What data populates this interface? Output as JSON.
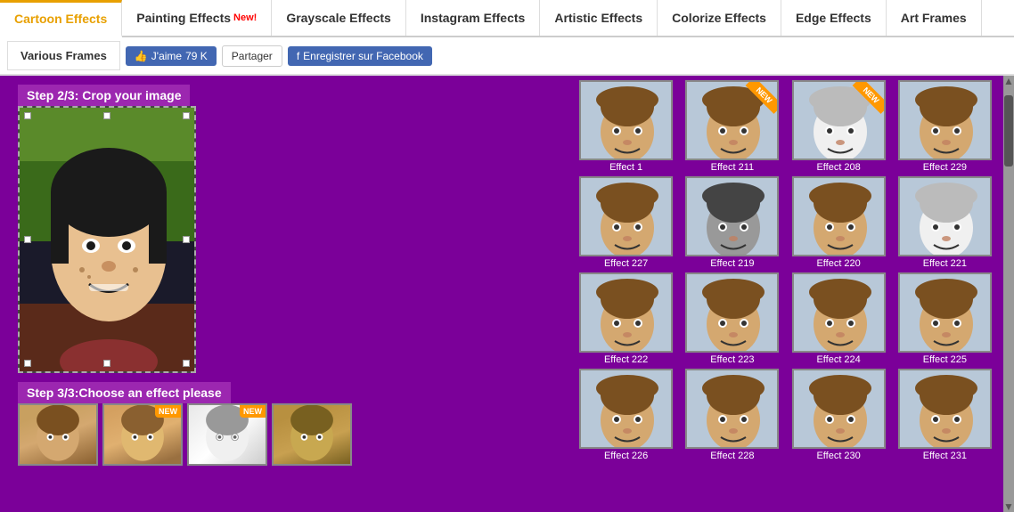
{
  "nav": {
    "tabs": [
      {
        "id": "cartoon",
        "label": "Cartoon Effects",
        "active": true,
        "new": false
      },
      {
        "id": "painting",
        "label": "Painting Effects",
        "active": false,
        "new": true,
        "new_label": "New!"
      },
      {
        "id": "grayscale",
        "label": "Grayscale Effects",
        "active": false,
        "new": false
      },
      {
        "id": "instagram",
        "label": "Instagram Effects",
        "active": false,
        "new": false
      },
      {
        "id": "artistic",
        "label": "Artistic Effects",
        "active": false,
        "new": false
      },
      {
        "id": "colorize",
        "label": "Colorize Effects",
        "active": false,
        "new": false
      },
      {
        "id": "edge",
        "label": "Edge Effects",
        "active": false,
        "new": false
      },
      {
        "id": "artframes",
        "label": "Art Frames",
        "active": false,
        "new": false
      }
    ],
    "various_frames": "Various Frames"
  },
  "social": {
    "like_label": "J'aime",
    "like_count": "79 K",
    "share_label": "Partager",
    "save_label": "Enregistrer sur Facebook"
  },
  "steps": {
    "step2": "Step 2/3: Crop your image",
    "step3": "Step 3/3:Choose an effect please"
  },
  "effects": [
    {
      "label": "Effect 1",
      "style": "ef1",
      "new": false
    },
    {
      "label": "Effect 211",
      "style": "ef2",
      "new": true
    },
    {
      "label": "Effect 208",
      "style": "ef3",
      "new": true
    },
    {
      "label": "Effect 229",
      "style": "ef4",
      "new": false
    },
    {
      "label": "Effect 227",
      "style": "ef5",
      "new": false
    },
    {
      "label": "Effect 219",
      "style": "ef6",
      "new": false
    },
    {
      "label": "Effect 220",
      "style": "ef7",
      "new": false
    },
    {
      "label": "Effect 221",
      "style": "ef8",
      "new": false
    },
    {
      "label": "Effect 222",
      "style": "ef9",
      "new": false
    },
    {
      "label": "Effect 223",
      "style": "ef10",
      "new": false
    },
    {
      "label": "Effect 224",
      "style": "ef11",
      "new": false
    },
    {
      "label": "Effect 225",
      "style": "ef12",
      "new": false
    },
    {
      "label": "Effect 226",
      "style": "ef13",
      "new": false
    },
    {
      "label": "Effect 228",
      "style": "ef14",
      "new": false
    },
    {
      "label": "Effect 230",
      "style": "ef15",
      "new": false
    },
    {
      "label": "Effect 231",
      "style": "ef16",
      "new": false
    }
  ],
  "bottom_thumbs": [
    {
      "style": "ef1",
      "new": false
    },
    {
      "style": "ef2",
      "new": true
    },
    {
      "style": "ef3",
      "new": true
    },
    {
      "style": "ef5",
      "new": false
    }
  ]
}
